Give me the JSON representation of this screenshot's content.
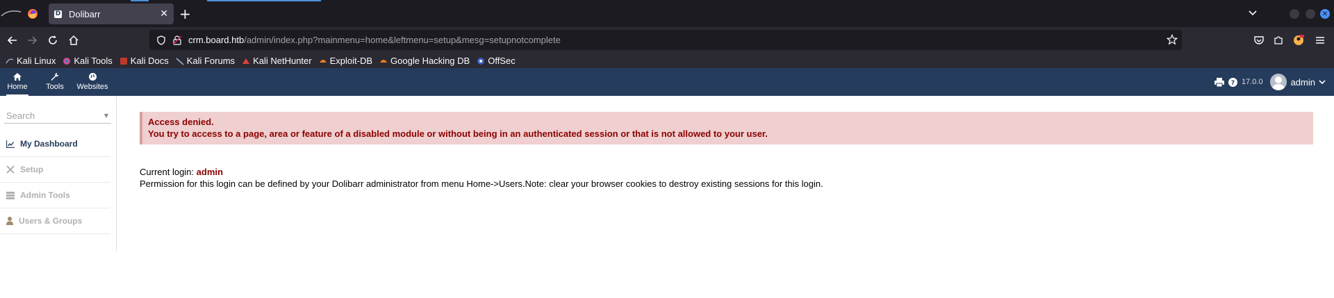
{
  "browser": {
    "tab_title": "Dolibarr",
    "tab_favicon_letter": "D",
    "url_host": "crm.board.htb",
    "url_path": "/admin/index.php?mainmenu=home&leftmenu=setup&mesg=setupnotcomplete",
    "bookmarks": [
      {
        "label": "Kali Linux",
        "icon": "kali-dragon-icon"
      },
      {
        "label": "Kali Tools",
        "icon": "kali-tools-icon"
      },
      {
        "label": "Kali Docs",
        "icon": "kali-docs-icon"
      },
      {
        "label": "Kali Forums",
        "icon": "kali-dragon-icon"
      },
      {
        "label": "Kali NetHunter",
        "icon": "nethunter-icon"
      },
      {
        "label": "Exploit-DB",
        "icon": "exploitdb-icon"
      },
      {
        "label": "Google Hacking DB",
        "icon": "ghdb-icon"
      },
      {
        "label": "OffSec",
        "icon": "offsec-icon"
      }
    ]
  },
  "topmenu": {
    "items": [
      {
        "label": "Home",
        "icon": "home-icon"
      },
      {
        "label": "Tools",
        "icon": "wrench-icon"
      },
      {
        "label": "Websites",
        "icon": "globe-icon"
      }
    ],
    "version": "17.0.0",
    "username": "admin"
  },
  "leftmenu": {
    "search_placeholder": "Search",
    "items": [
      {
        "label": "My Dashboard",
        "icon": "chart-icon"
      },
      {
        "label": "Setup",
        "icon": "tools-icon"
      },
      {
        "label": "Admin Tools",
        "icon": "server-icon"
      },
      {
        "label": "Users & Groups",
        "icon": "user-icon"
      }
    ]
  },
  "content": {
    "error_title": "Access denied.",
    "error_message": "You try to access to a page, area or feature of a disabled module or without being in an authenticated session or that is not allowed to your user.",
    "current_login_label": "Current login: ",
    "current_login_user": "admin",
    "permission_note": "Permission for this login can be defined by your Dolibarr administrator from menu Home->Users.Note: clear your browser cookies to destroy existing sessions for this login."
  },
  "colors": {
    "topbar": "#263c5c",
    "error_bg": "#efcfcf",
    "error_text": "#8b0000"
  }
}
